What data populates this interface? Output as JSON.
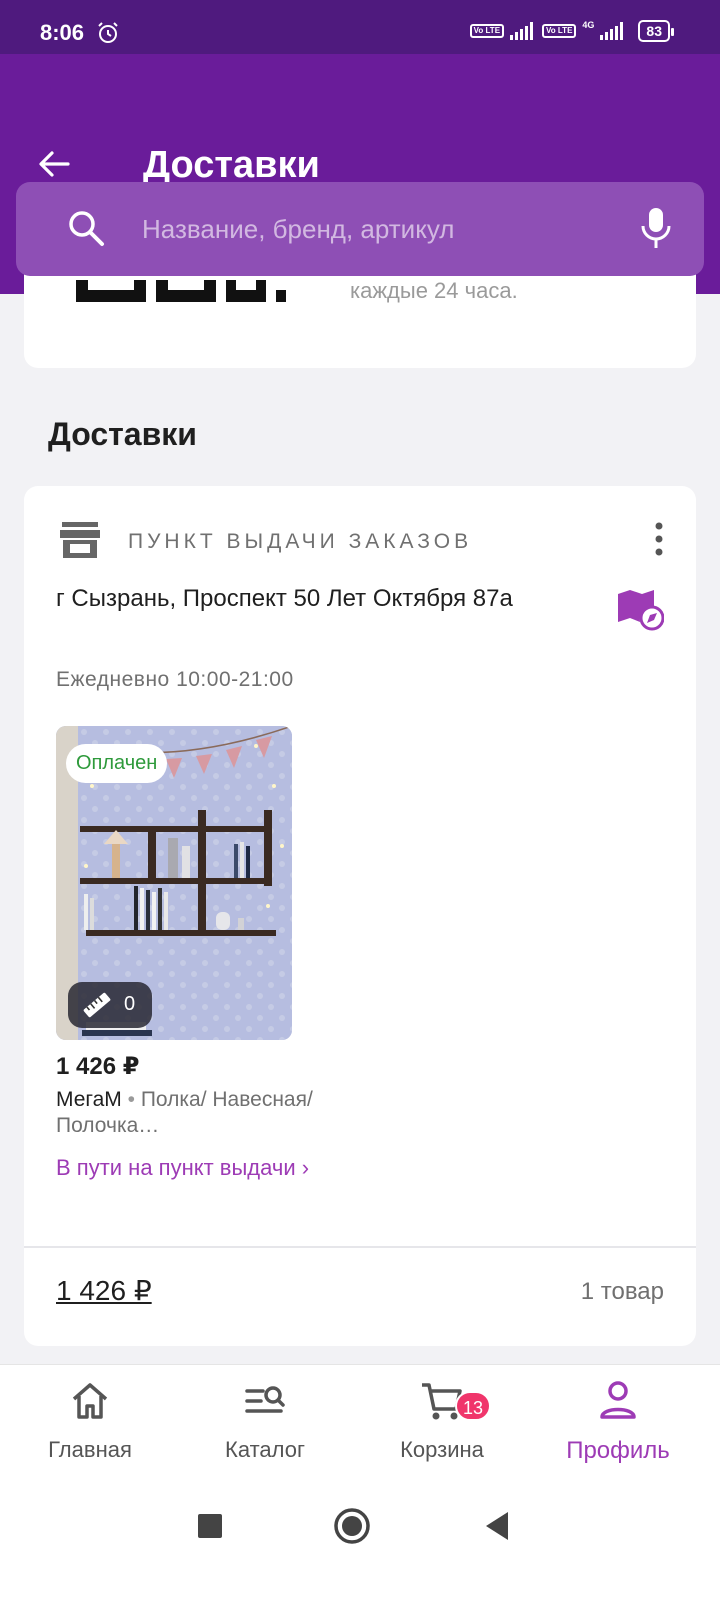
{
  "status_bar": {
    "time": "8:06",
    "alarm_icon": "alarm-icon",
    "volte_1": "Vo LTE",
    "volte_2": "Vo LTE",
    "network": "4G",
    "battery": "83"
  },
  "app_bar": {
    "title": "Доставки",
    "back_icon": "arrow-back-icon"
  },
  "search": {
    "placeholder": "Название, бренд, артикул",
    "icon": "search-icon",
    "mic_icon": "mic-icon"
  },
  "top_card": {
    "partial_text": "каждые 24 часа."
  },
  "section": {
    "title": "Доставки"
  },
  "delivery": {
    "type_label": "ПУНКТ ВЫДАЧИ ЗАКАЗОВ",
    "address": "г Сызрань, Проспект 50 Лет Октября 87а",
    "hours": "Ежедневно 10:00-21:00",
    "product": {
      "badge": "Оплачен",
      "size_count": "0",
      "price": "1 426 ₽",
      "brand": "МегаМ",
      "separator": " • ",
      "name": "Полка/ Навесная/Полочка…",
      "status": "В пути на пункт выдачи ›"
    },
    "total": "1 426 ₽",
    "items_count": "1 товар"
  },
  "bottom_nav": {
    "items": [
      {
        "label": "Главная",
        "icon": "home-icon"
      },
      {
        "label": "Каталог",
        "icon": "catalog-search-icon"
      },
      {
        "label": "Корзина",
        "icon": "cart-icon",
        "badge": "13"
      },
      {
        "label": "Профиль",
        "icon": "profile-icon",
        "active": true
      }
    ]
  },
  "colors": {
    "status_bar": "#4f1a7e",
    "app_bar": "#6a1c9a",
    "accent": "#9d3bb5",
    "paid": "#2e9a3b",
    "badge": "#f0356b"
  }
}
